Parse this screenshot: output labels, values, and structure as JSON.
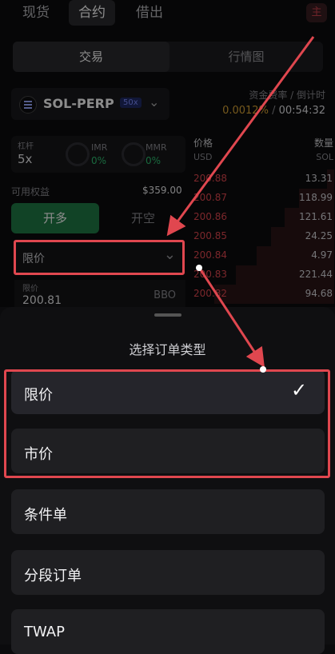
{
  "top_tabs": [
    {
      "label": "现货"
    },
    {
      "label": "合约"
    },
    {
      "label": "借出"
    }
  ],
  "avatar_text": "主",
  "segments": [
    {
      "label": "交易"
    },
    {
      "label": "行情图"
    }
  ],
  "symbol": {
    "name": "SOL-PERP",
    "leverage_badge": "50x"
  },
  "funding": {
    "label": "资金费率 / 倒计时",
    "rate": "0.0012%",
    "separator": "/",
    "countdown": "00:54:32"
  },
  "leverage": {
    "label": "杠杆",
    "value": "5x"
  },
  "imr": {
    "label": "IMR",
    "value": "0%"
  },
  "mmr": {
    "label": "MMR",
    "value": "0%"
  },
  "balance": {
    "label": "可用权益",
    "value": "$359.00"
  },
  "side": {
    "long": "开多",
    "short": "开空"
  },
  "order_type_select": {
    "value": "限价"
  },
  "price_input": {
    "label": "限价",
    "value": "200.81",
    "bbo": "BBO"
  },
  "orderbook": {
    "price_header": "价格",
    "size_header": "数量",
    "price_unit": "USD",
    "size_unit": "SOL",
    "asks": [
      {
        "price": "200.88",
        "size": "13.31",
        "depth": 0.05
      },
      {
        "price": "200.87",
        "size": "118.99",
        "depth": 0.25
      },
      {
        "price": "200.86",
        "size": "121.61",
        "depth": 0.35
      },
      {
        "price": "200.85",
        "size": "24.25",
        "depth": 0.45
      },
      {
        "price": "200.84",
        "size": "4.97",
        "depth": 0.55
      },
      {
        "price": "200.83",
        "size": "221.44",
        "depth": 0.7
      },
      {
        "price": "200.82",
        "size": "94.68",
        "depth": 0.85
      }
    ]
  },
  "sheet": {
    "title": "选择订单类型",
    "options": [
      {
        "label": "限价",
        "selected": true
      },
      {
        "label": "市价",
        "selected": false
      },
      {
        "label": "条件单",
        "selected": false
      },
      {
        "label": "分段订单",
        "selected": false
      },
      {
        "label": "TWAP",
        "selected": false
      }
    ]
  },
  "colors": {
    "accent_red": "#e0474f",
    "long_green": "#1f7a45",
    "profit_green": "#2fbf71"
  }
}
